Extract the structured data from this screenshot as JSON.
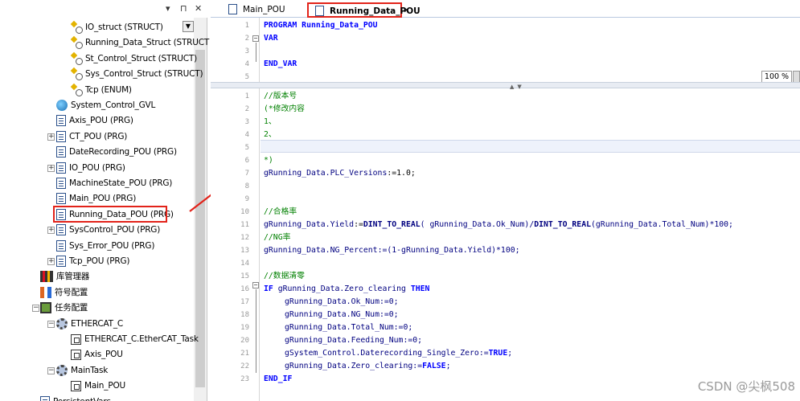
{
  "project_tree": {
    "items": [
      {
        "label": "IO_struct (STRUCT)",
        "icon": "struct-icon"
      },
      {
        "label": "Running_Data_Struct (STRUCT",
        "icon": "struct-icon"
      },
      {
        "label": "St_Control_Struct (STRUCT)",
        "icon": "struct-icon"
      },
      {
        "label": "Sys_Control_Struct (STRUCT)",
        "icon": "struct-icon"
      },
      {
        "label": "Tcp (ENUM)",
        "icon": "struct-icon"
      },
      {
        "label": "System_Control_GVL",
        "icon": "globe-icon"
      },
      {
        "label": "Axis_POU (PRG)",
        "icon": "document-icon"
      },
      {
        "label": "CT_POU (PRG)",
        "icon": "document-icon"
      },
      {
        "label": "DateRecording_POU (PRG)",
        "icon": "document-icon"
      },
      {
        "label": "IO_POU (PRG)",
        "icon": "document-icon"
      },
      {
        "label": "MachineState_POU (PRG)",
        "icon": "document-icon"
      },
      {
        "label": "Main_POU (PRG)",
        "icon": "document-icon"
      },
      {
        "label": "Running_Data_POU (PRG)",
        "icon": "document-icon"
      },
      {
        "label": "SysControl_POU (PRG)",
        "icon": "document-icon"
      },
      {
        "label": "Sys_Error_POU (PRG)",
        "icon": "document-icon"
      },
      {
        "label": "Tcp_POU (PRG)",
        "icon": "document-icon"
      },
      {
        "label": "库管理器",
        "icon": "library-icon"
      },
      {
        "label": "符号配置",
        "icon": "symbol-icon"
      },
      {
        "label": "任务配置",
        "icon": "task-config-icon"
      },
      {
        "label": "ETHERCAT_C",
        "icon": "gear-icon"
      },
      {
        "label": "ETHERCAT_C.EtherCAT_Task",
        "icon": "program-call-icon"
      },
      {
        "label": "Axis_POU",
        "icon": "program-call-icon"
      },
      {
        "label": "MainTask",
        "icon": "gear-icon"
      },
      {
        "label": "Main_POU",
        "icon": "program-call-icon"
      },
      {
        "label": "PersistentVars",
        "icon": "document-icon"
      }
    ],
    "header_pin": "▾ ⊓ ✕"
  },
  "tabs": [
    {
      "label": "Main_POU",
      "active": false
    },
    {
      "label": "Running_Data_POU",
      "active": true
    }
  ],
  "tab_close": "✕",
  "declaration": {
    "lines": [
      {
        "num": "1",
        "text": "PROGRAM Running_Data_POU"
      },
      {
        "num": "2",
        "text": "VAR"
      },
      {
        "num": "3",
        "text": ""
      },
      {
        "num": "4",
        "text": "END_VAR"
      },
      {
        "num": "5",
        "text": ""
      }
    ]
  },
  "zoom": "100 %",
  "implementation": {
    "line_numbers": [
      "1",
      "2",
      "3",
      "4",
      "5",
      "6",
      "7",
      "8",
      "9",
      "10",
      "11",
      "12",
      "13",
      "14",
      "15",
      "16",
      "17",
      "18",
      "19",
      "20",
      "21",
      "22",
      "23"
    ],
    "comments": {
      "version": "//版本号",
      "modify": "(*修改内容",
      "item1": "1、",
      "item2": "2、",
      "close": "*)",
      "yield": "//合格率",
      "ng": "//NG率",
      "clear": "//数据清零"
    },
    "l7_id": "gRunning_Data.PLC_Versions",
    "l7_val": ":=1.0;",
    "l11_id": "gRunning_Data.Yield",
    "l11_a": ":=",
    "l11_fn1": "DINT_TO_REAL",
    "l11_b": "( gRunning_Data.Ok_Num)/",
    "l11_fn2": "DINT_TO_REAL",
    "l11_c": "(gRunning_Data.Total_Num)*100;",
    "l13_id": "gRunning_Data.NG_Percent",
    "l13_b": ":=(1-gRunning_Data.Yield)*100;",
    "l16_if": "IF",
    "l16_cond": " gRunning_Data.Zero_clearing ",
    "l16_then": "THEN",
    "l17": "gRunning_Data.Ok_Num:=0;",
    "l18": "gRunning_Data.NG_Num:=0;",
    "l19": "gRunning_Data.Total_Num:=0;",
    "l20": "gRunning_Data.Feeding_Num:=0;",
    "l21a": "gSystem_Control.Daterecording_Single_Zero:=",
    "l21b": "TRUE",
    "l22a": "gRunning_Data.Zero_clearing:=",
    "l22b": "FALSE",
    "l23": "END_IF"
  },
  "watermark": "CSDN @尖枫508"
}
